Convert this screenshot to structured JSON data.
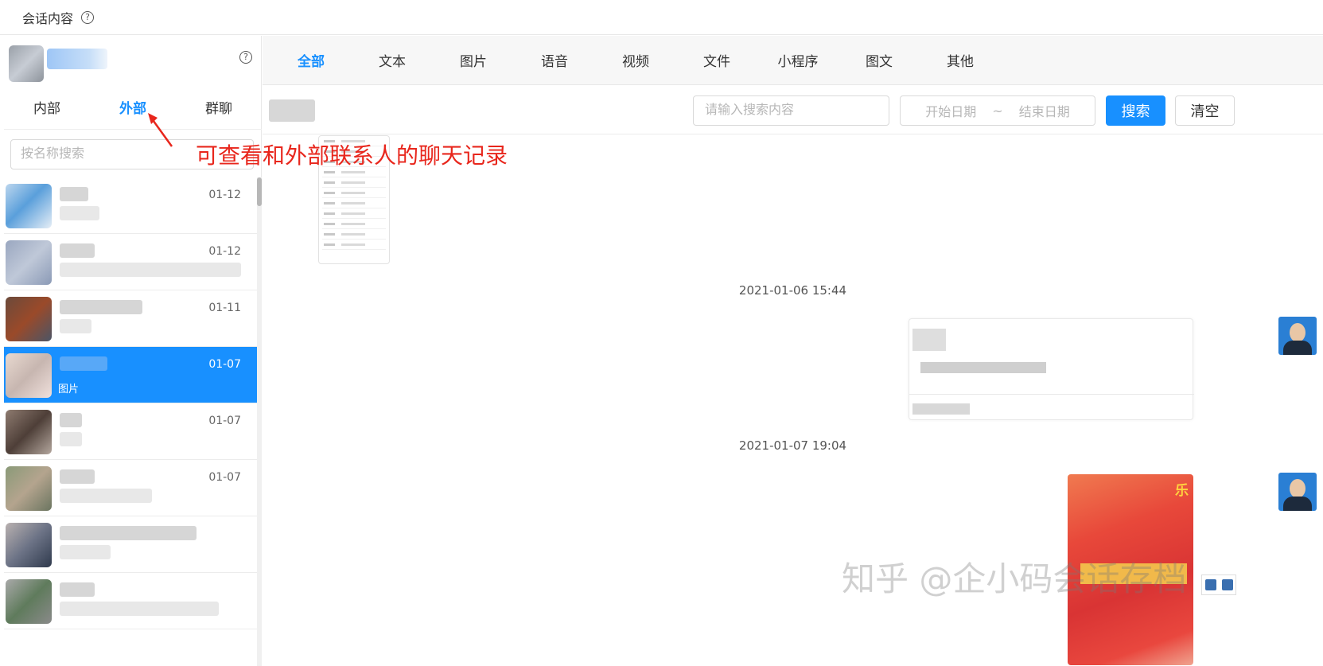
{
  "header": {
    "title": "会话内容",
    "help_icon": "?"
  },
  "sidebar": {
    "subtabs": [
      {
        "label": "内部",
        "active": false
      },
      {
        "label": "外部",
        "active": true
      },
      {
        "label": "群聊",
        "active": false
      }
    ],
    "search_placeholder": "按名称搜索",
    "conversations": [
      {
        "date": "01-12",
        "preview": "",
        "active": false
      },
      {
        "date": "01-12",
        "preview": "",
        "active": false
      },
      {
        "date": "01-11",
        "preview": "",
        "active": false
      },
      {
        "date": "01-07",
        "preview": "图片",
        "active": true
      },
      {
        "date": "01-07",
        "preview": "",
        "active": false
      },
      {
        "date": "01-07",
        "preview": "",
        "active": false
      },
      {
        "date": "",
        "preview": "",
        "active": false
      },
      {
        "date": "",
        "preview": "",
        "active": false
      }
    ]
  },
  "main": {
    "type_tabs": [
      "全部",
      "文本",
      "图片",
      "语音",
      "视频",
      "文件",
      "小程序",
      "图文",
      "其他"
    ],
    "active_tab": "全部",
    "filter": {
      "keyword_placeholder": "请输入搜索内容",
      "start_date_placeholder": "开始日期",
      "date_separator": "~",
      "end_date_placeholder": "结束日期",
      "search_label": "搜索",
      "clear_label": "清空"
    },
    "timestamps": [
      "2021-01-06 15:44",
      "2021-01-07 19:04"
    ],
    "red_packet_text": "乐"
  },
  "annotation": {
    "text": "可查看和外部联系人的聊天记录",
    "color": "#e8261c"
  },
  "watermark": "知乎 @企小码会话存档",
  "colors": {
    "accent": "#1890ff",
    "annotation": "#e8261c"
  }
}
